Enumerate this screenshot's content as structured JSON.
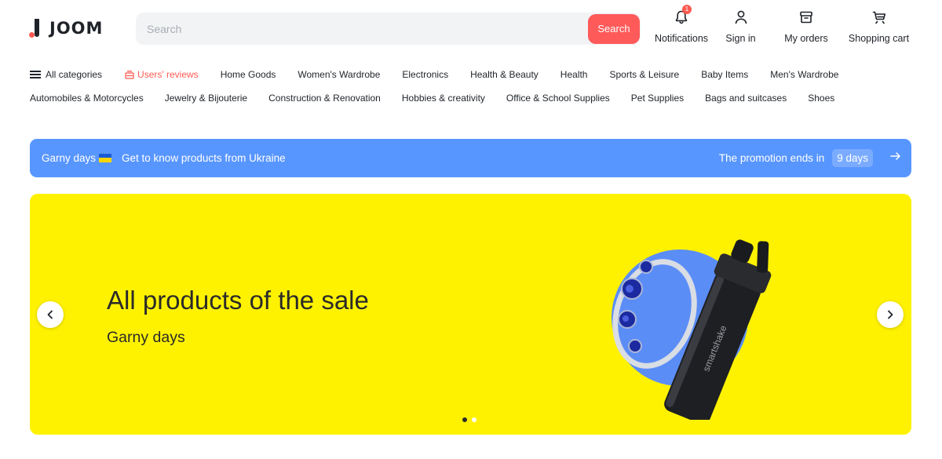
{
  "brand": {
    "name": "JOOM"
  },
  "search": {
    "placeholder": "Search",
    "button_label": "Search"
  },
  "header_actions": {
    "notifications": {
      "label": "Notifications",
      "icon": "bell-icon",
      "badge": "1"
    },
    "sign_in": {
      "label": "Sign in",
      "icon": "user-icon"
    },
    "orders": {
      "label": "My orders",
      "icon": "box-icon"
    },
    "cart": {
      "label": "Shopping cart",
      "icon": "cart-icon"
    }
  },
  "nav": {
    "all_categories": "All categories",
    "reviews": "Users' reviews",
    "row1": [
      "Home Goods",
      "Women's Wardrobe",
      "Electronics",
      "Health & Beauty",
      "Health",
      "Sports & Leisure",
      "Baby Items",
      "Men's Wardrobe"
    ],
    "row2": [
      "Automobiles & Motorcycles",
      "Jewelry & Bijouterie",
      "Construction & Renovation",
      "Hobbies & creativity",
      "Office & School Supplies",
      "Pet Supplies",
      "Bags and suitcases",
      "Shoes"
    ]
  },
  "promo": {
    "title": "Garny days",
    "text": "Get to know products from Ukraine",
    "ends_label": "The promotion ends in",
    "days": "9 days"
  },
  "hero": {
    "title": "All products of the sale",
    "subtitle": "Garny days",
    "product_brand_text": "smartshake",
    "slide_count": 2,
    "active_slide": 1
  },
  "colors": {
    "accent": "#ff5a52",
    "promo_bg": "#5896ff",
    "hero_bg": "#fff200",
    "hero_circle": "#5b8df7"
  }
}
